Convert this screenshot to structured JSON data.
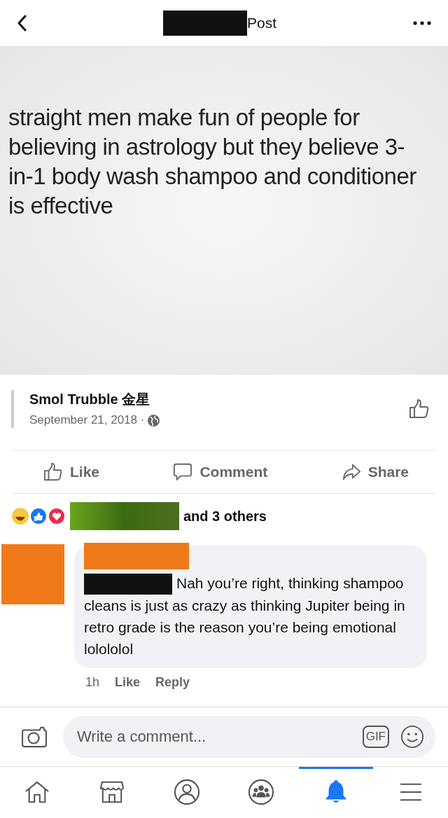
{
  "header": {
    "title": "Post"
  },
  "post_image": {
    "text": "straight men make fun of people for believing in astrology but they believe 3-in-1 body wash shampoo and conditioner is effective"
  },
  "author": {
    "name": "Smol Trubble 金星",
    "date": "September 21, 2018 ·"
  },
  "actions": [
    {
      "kind": "like",
      "label": "Like"
    },
    {
      "kind": "comment",
      "label": "Comment"
    },
    {
      "kind": "share",
      "label": "Share"
    }
  ],
  "reactions": {
    "others": "and 3 others"
  },
  "comment": {
    "text": "Nah you’re right, thinking shampoo cleans is just as crazy as thinking Jupiter being in retro grade is the reason you’re being emotional lolololol",
    "time": "1h",
    "like": "Like",
    "reply": "Reply"
  },
  "composer": {
    "placeholder": "Write a comment...",
    "gif": "GIF"
  },
  "nav": [
    {
      "kind": "home",
      "selected": false
    },
    {
      "kind": "marketplace",
      "selected": false
    },
    {
      "kind": "profile",
      "selected": false
    },
    {
      "kind": "groups",
      "selected": false
    },
    {
      "kind": "notifications",
      "selected": true
    },
    {
      "kind": "menu",
      "selected": false
    }
  ]
}
